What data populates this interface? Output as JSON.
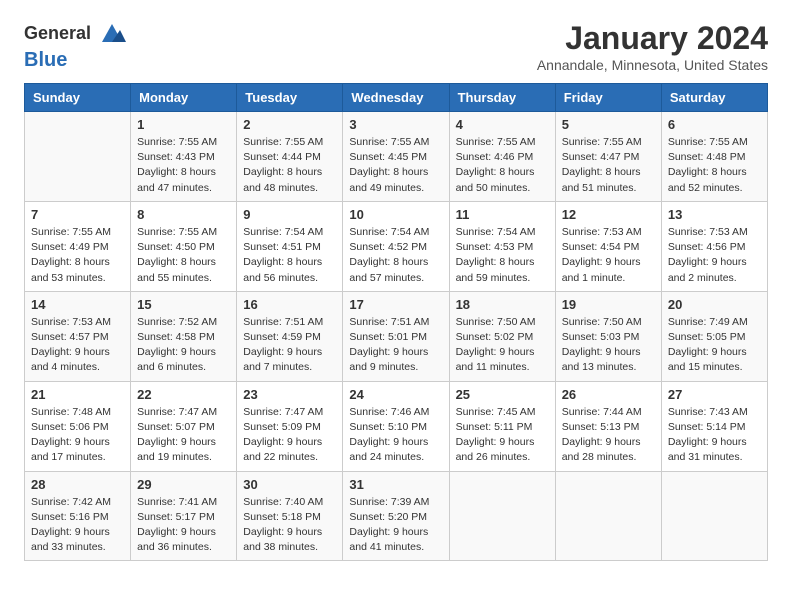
{
  "logo": {
    "line1": "General",
    "line2": "Blue",
    "icon_color": "#2a6db5"
  },
  "title": "January 2024",
  "subtitle": "Annandale, Minnesota, United States",
  "header_days": [
    "Sunday",
    "Monday",
    "Tuesday",
    "Wednesday",
    "Thursday",
    "Friday",
    "Saturday"
  ],
  "weeks": [
    [
      {
        "day": "",
        "content": ""
      },
      {
        "day": "1",
        "content": "Sunrise: 7:55 AM\nSunset: 4:43 PM\nDaylight: 8 hours\nand 47 minutes."
      },
      {
        "day": "2",
        "content": "Sunrise: 7:55 AM\nSunset: 4:44 PM\nDaylight: 8 hours\nand 48 minutes."
      },
      {
        "day": "3",
        "content": "Sunrise: 7:55 AM\nSunset: 4:45 PM\nDaylight: 8 hours\nand 49 minutes."
      },
      {
        "day": "4",
        "content": "Sunrise: 7:55 AM\nSunset: 4:46 PM\nDaylight: 8 hours\nand 50 minutes."
      },
      {
        "day": "5",
        "content": "Sunrise: 7:55 AM\nSunset: 4:47 PM\nDaylight: 8 hours\nand 51 minutes."
      },
      {
        "day": "6",
        "content": "Sunrise: 7:55 AM\nSunset: 4:48 PM\nDaylight: 8 hours\nand 52 minutes."
      }
    ],
    [
      {
        "day": "7",
        "content": "Sunrise: 7:55 AM\nSunset: 4:49 PM\nDaylight: 8 hours\nand 53 minutes."
      },
      {
        "day": "8",
        "content": "Sunrise: 7:55 AM\nSunset: 4:50 PM\nDaylight: 8 hours\nand 55 minutes."
      },
      {
        "day": "9",
        "content": "Sunrise: 7:54 AM\nSunset: 4:51 PM\nDaylight: 8 hours\nand 56 minutes."
      },
      {
        "day": "10",
        "content": "Sunrise: 7:54 AM\nSunset: 4:52 PM\nDaylight: 8 hours\nand 57 minutes."
      },
      {
        "day": "11",
        "content": "Sunrise: 7:54 AM\nSunset: 4:53 PM\nDaylight: 8 hours\nand 59 minutes."
      },
      {
        "day": "12",
        "content": "Sunrise: 7:53 AM\nSunset: 4:54 PM\nDaylight: 9 hours\nand 1 minute."
      },
      {
        "day": "13",
        "content": "Sunrise: 7:53 AM\nSunset: 4:56 PM\nDaylight: 9 hours\nand 2 minutes."
      }
    ],
    [
      {
        "day": "14",
        "content": "Sunrise: 7:53 AM\nSunset: 4:57 PM\nDaylight: 9 hours\nand 4 minutes."
      },
      {
        "day": "15",
        "content": "Sunrise: 7:52 AM\nSunset: 4:58 PM\nDaylight: 9 hours\nand 6 minutes."
      },
      {
        "day": "16",
        "content": "Sunrise: 7:51 AM\nSunset: 4:59 PM\nDaylight: 9 hours\nand 7 minutes."
      },
      {
        "day": "17",
        "content": "Sunrise: 7:51 AM\nSunset: 5:01 PM\nDaylight: 9 hours\nand 9 minutes."
      },
      {
        "day": "18",
        "content": "Sunrise: 7:50 AM\nSunset: 5:02 PM\nDaylight: 9 hours\nand 11 minutes."
      },
      {
        "day": "19",
        "content": "Sunrise: 7:50 AM\nSunset: 5:03 PM\nDaylight: 9 hours\nand 13 minutes."
      },
      {
        "day": "20",
        "content": "Sunrise: 7:49 AM\nSunset: 5:05 PM\nDaylight: 9 hours\nand 15 minutes."
      }
    ],
    [
      {
        "day": "21",
        "content": "Sunrise: 7:48 AM\nSunset: 5:06 PM\nDaylight: 9 hours\nand 17 minutes."
      },
      {
        "day": "22",
        "content": "Sunrise: 7:47 AM\nSunset: 5:07 PM\nDaylight: 9 hours\nand 19 minutes."
      },
      {
        "day": "23",
        "content": "Sunrise: 7:47 AM\nSunset: 5:09 PM\nDaylight: 9 hours\nand 22 minutes."
      },
      {
        "day": "24",
        "content": "Sunrise: 7:46 AM\nSunset: 5:10 PM\nDaylight: 9 hours\nand 24 minutes."
      },
      {
        "day": "25",
        "content": "Sunrise: 7:45 AM\nSunset: 5:11 PM\nDaylight: 9 hours\nand 26 minutes."
      },
      {
        "day": "26",
        "content": "Sunrise: 7:44 AM\nSunset: 5:13 PM\nDaylight: 9 hours\nand 28 minutes."
      },
      {
        "day": "27",
        "content": "Sunrise: 7:43 AM\nSunset: 5:14 PM\nDaylight: 9 hours\nand 31 minutes."
      }
    ],
    [
      {
        "day": "28",
        "content": "Sunrise: 7:42 AM\nSunset: 5:16 PM\nDaylight: 9 hours\nand 33 minutes."
      },
      {
        "day": "29",
        "content": "Sunrise: 7:41 AM\nSunset: 5:17 PM\nDaylight: 9 hours\nand 36 minutes."
      },
      {
        "day": "30",
        "content": "Sunrise: 7:40 AM\nSunset: 5:18 PM\nDaylight: 9 hours\nand 38 minutes."
      },
      {
        "day": "31",
        "content": "Sunrise: 7:39 AM\nSunset: 5:20 PM\nDaylight: 9 hours\nand 41 minutes."
      },
      {
        "day": "",
        "content": ""
      },
      {
        "day": "",
        "content": ""
      },
      {
        "day": "",
        "content": ""
      }
    ]
  ]
}
